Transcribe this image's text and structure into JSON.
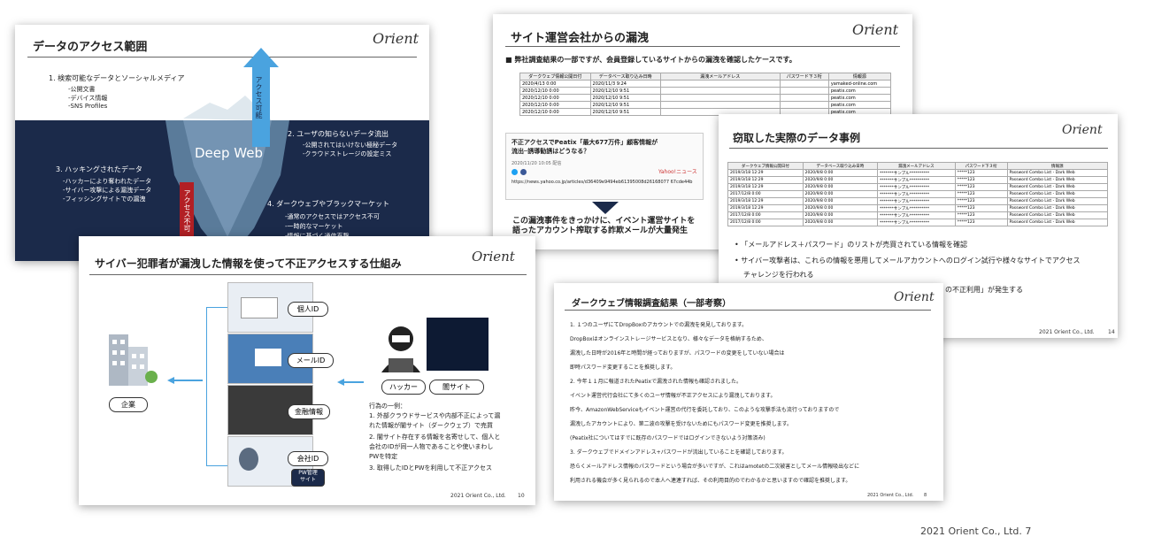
{
  "slide1": {
    "title": "データのアクセス範囲",
    "logo": "Orient",
    "item1": "1. 検索可能なデータとソーシャルメディア",
    "item1_sub": [
      "-公開文書",
      "-デバイス情報",
      "-SNS Profiles"
    ],
    "access_ok": "アクセス可能",
    "deep_web": "Deep Web",
    "item2": "2. ユーザの知らないデータ流出",
    "item2_sub": [
      "-公開されてはいけない極秘データ",
      "-クラウドストレージの設定ミス"
    ],
    "item3": "3. ハッキングされたデータ",
    "item3_sub": [
      "-ハッカーにより奪われたデータ",
      "-サイバー攻撃による漏洩データ",
      "-フィッシングサイトでの漏洩"
    ],
    "access_ng": "アクセス不可",
    "item4": "4. ダークウェブやブラックマーケット",
    "item4_sub": [
      "-通常のアクセスではアクセス不可",
      "-一時的なマーケット",
      "-情報に基づく通信直撃"
    ]
  },
  "slide2": {
    "title": "サイト運営会社からの漏洩",
    "logo": "Orient",
    "bullet": "■ 弊社調査結果の一部ですが、会員登録しているサイトからの漏洩を確認したケースです。",
    "headers": [
      "ダークウェブ情報公開日付",
      "データベース取り込み日時",
      "漏洩メールアドレス",
      "パスワード下３桁",
      "情報源"
    ],
    "rows": [
      [
        "2020/4/13 0:00",
        "2020/11/3 9:24",
        "",
        "",
        "yamaked-online.com"
      ],
      [
        "2020/12/10 0:00",
        "2020/12/10 9:51",
        "",
        "",
        "peatix.com"
      ],
      [
        "2020/12/10 0:00",
        "2020/12/10 9:51",
        "",
        "",
        "peatix.com"
      ],
      [
        "2020/12/10 0:00",
        "2020/12/10 9:51",
        "",
        "",
        "peatix.com"
      ],
      [
        "2020/12/10 0:00",
        "2020/12/10 9:51",
        "",
        "",
        "peatix.com"
      ]
    ],
    "news_title": "不正アクセスでPeatix「最大677万件」顧客情報が流出─誘導勧誘はどうなる？",
    "news_meta": "2020/11/20 10:05 配信",
    "news_source": "Yahoo!ニュース",
    "news_url": "https://news.yahoo.co.jp/articles/d36409e9494eb61395008d26168077 67cde44b",
    "conclusion": "この漏洩事件をきっかけに、イベント運営サイトを\n語ったアカウント搾取する詐欺メールが大量発生"
  },
  "slide3": {
    "title": "窃取した実際のデータ事例",
    "logo": "Orient",
    "headers": [
      "ダークウェブ情報公開日付",
      "データベース取り込み日時",
      "漏洩メールアドレス",
      "パスワード下３桁",
      "情報源"
    ],
    "rows": [
      [
        "2019/3/18 12:29",
        "2020/9/8 0:00",
        "*******サンプル**********",
        "*****123",
        "Password Combo List - Dark Web"
      ],
      [
        "2019/3/18 12:29",
        "2020/9/8 0:00",
        "*******サンプル**********",
        "*****123",
        "Password Combo List - Dark Web"
      ],
      [
        "2019/3/18 12:29",
        "2020/9/8 0:00",
        "*******サンプル**********",
        "*****123",
        "Password Combo List - Dark Web"
      ],
      [
        "2017/12/8 0:00",
        "2020/9/8 0:00",
        "*******サンプル**********",
        "*****123",
        "Password Combo List - Dark Web"
      ],
      [
        "2019/3/18 12:29",
        "2020/9/8 0:00",
        "*******サンプル**********",
        "*****123",
        "Password Combo List - Dark Web"
      ],
      [
        "2019/3/18 12:29",
        "2020/9/8 0:00",
        "*******サンプル**********",
        "*****123",
        "Password Combo List - Dark Web"
      ],
      [
        "2017/12/8 0:00",
        "2020/9/8 0:00",
        "*******サンプル**********",
        "*****123",
        "Password Combo List - Dark Web"
      ],
      [
        "2017/12/8 0:00",
        "2020/9/8 0:00",
        "*******サンプル**********",
        "*****123",
        "Password Combo List - Dark Web"
      ]
    ],
    "bullets": [
      "「メールアドレス＋パスワード」のリストが売買されている情報を確認",
      "サイバー攻撃者は、これらの情報を悪用してメールアカウントへのログイン試行や様々なサイトでアクセス",
      "チャレンジを行われる",
      "の不正利用」が発生する"
    ],
    "footer": "2021 Orient Co., Ltd.",
    "page": "14"
  },
  "slide4": {
    "title": "サイバー犯罪者が漏洩した情報を使って不正アクセスする仕組み",
    "logo": "Orient",
    "company": "企業",
    "labels": [
      "個人ID",
      "メールID",
      "金融情報",
      "会社ID",
      "PW管理\nサイト"
    ],
    "hacker": "ハッカー",
    "darksite": "闇サイト",
    "example_head": "行為の一例：",
    "examples": [
      "1. 外部クラウドサービスや内部不正によって漏",
      "   れた情報が闇サイト（ダークウェブ）で売買",
      "2. 闇サイト存在する情報を名寄せして、個人と",
      "   会社のIDが同一人物であることや使いまわし",
      "   PWを特定",
      "3. 取得したIDとPWを利用して不正アクセス"
    ],
    "footer": "2021 Orient Co., Ltd.",
    "page": "10"
  },
  "slide5": {
    "title": "ダークウェブ情報調査結果（一部考察）",
    "logo": "Orient",
    "lines": [
      "1. １つのユーザにてDropBoxのアカウントでの漏洩を発見しております。",
      "   DropBoxはオンラインストレージサービスとなり、様々なデータを格納するため、",
      "   漏洩した日時が2016年と時間が経っておりますが、パスワードの変更をしていない場合は",
      "   即時パスワード変更することを推奨します。",
      "2. 今年１１月に報道されたPeatixで漏洩された情報も確認されました。",
      "   イベント運営代行会社にて多くのユーザ情報が不正アクセスにより漏洩しております。",
      "   昨今、AmazonWebServiceもイベント運営の代行を委託しており、このような攻撃手法も流行っておりますので",
      "   漏洩したアカウントにより、第二波の攻撃を受けないためにもパスワード変更を推奨します。",
      "  (Peatix社についてはすでに既存のパスワードではログインできないよう対策済み)",
      "3. ダークウェブでドメインアドレス+パスワードが流出していることを確認しております。",
      "   恐らくメールアドレス情報のパスワードという場合が多いですが、これはamotetの二次被害としてメール情報吸出などに",
      "   利用される機会が多く見られるので本人へ連連すれば、その利用目的のでわかるかと思いますので確認を推奨します。"
    ],
    "footer": "2021 Orient Co., Ltd.",
    "page": "8"
  },
  "bottom_text": "2021 Orient Co., Ltd. 7",
  "colors": {
    "navy": "#1b2a4a",
    "arrow": "#4aa3df",
    "card": "#dce6f0",
    "accent": "#7a2b2b"
  }
}
